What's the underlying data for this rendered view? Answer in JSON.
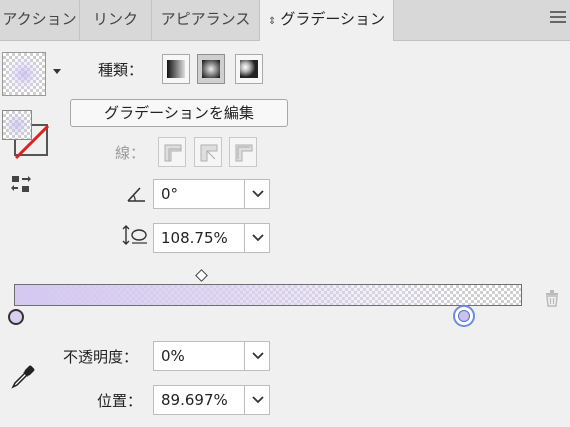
{
  "tabs": [
    {
      "label": "アクション",
      "active": false
    },
    {
      "label": "リンク",
      "active": false
    },
    {
      "label": "アピアランス",
      "active": false
    },
    {
      "label": "グラデーション",
      "active": true
    }
  ],
  "type_label": "種類：",
  "type_options": [
    {
      "name": "linear",
      "selected": false
    },
    {
      "name": "radial",
      "selected": true
    },
    {
      "name": "freeform",
      "selected": false
    }
  ],
  "edit_gradient_label": "グラデーションを編集",
  "stroke_label": "線：",
  "angle": {
    "value": "0°",
    "icon": "angle-icon"
  },
  "aspect_ratio": {
    "value": "108.75%",
    "icon": "aspect-ratio-icon"
  },
  "opacity": {
    "label": "不透明度：",
    "value": "0%"
  },
  "location": {
    "label": "位置：",
    "value": "89.697%"
  },
  "gradient_slider": {
    "start_color": "#d4c8f0",
    "end_color": "#c9c2f0",
    "midpoint_percent": 37,
    "selected_stop_percent": 89.697
  },
  "colors": {
    "accent": "#6b8de8",
    "none_slash": "#e02020"
  }
}
